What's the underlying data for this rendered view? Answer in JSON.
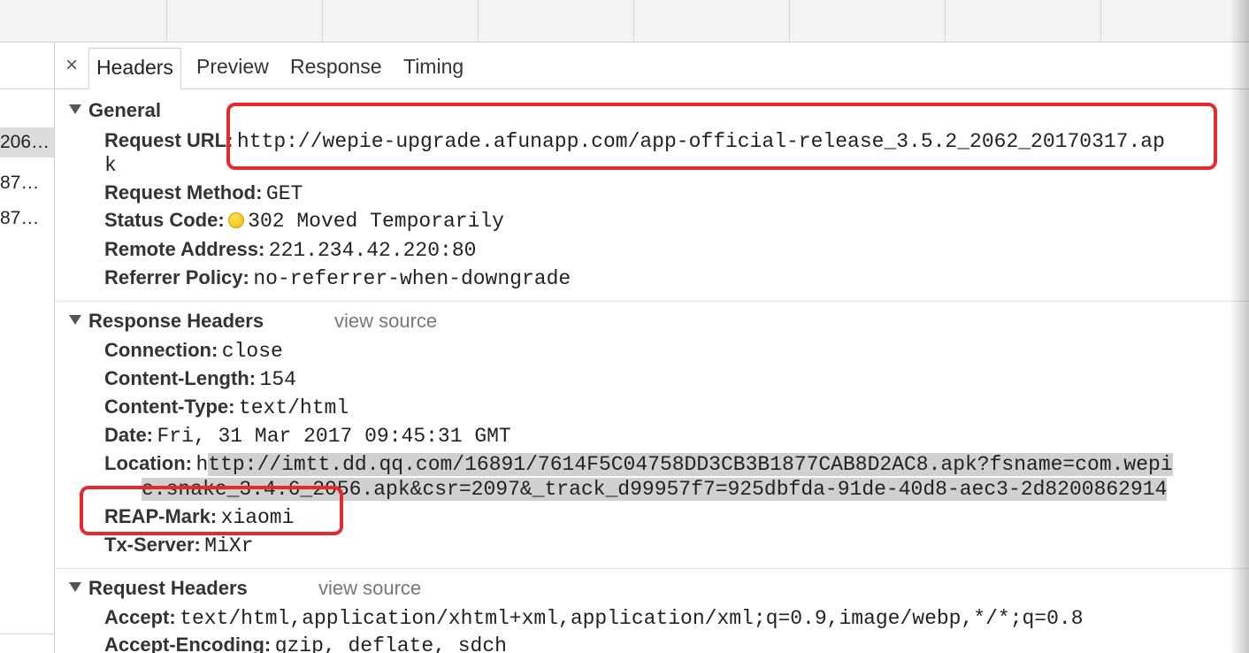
{
  "request_list": {
    "rows": [
      "206…",
      "87…",
      "87…"
    ]
  },
  "tabs": {
    "close_glyph": "×",
    "items": [
      "Headers",
      "Preview",
      "Response",
      "Timing"
    ],
    "active": "Headers"
  },
  "general": {
    "title": "General",
    "request_url_label": "Request URL:",
    "request_url_line1": "http://wepie-upgrade.afunapp.com/app-official-release_3.5.2_2062_20170317.ap",
    "request_url_line2": "k",
    "method_label": "Request Method:",
    "method": "GET",
    "status_label": "Status Code:",
    "status": "302 Moved Temporarily",
    "status_color": "#f2b600",
    "remote_label": "Remote Address:",
    "remote": "221.234.42.220:80",
    "referrer_label": "Referrer Policy:",
    "referrer": "no-referrer-when-downgrade"
  },
  "response_headers": {
    "title": "Response Headers",
    "view_source": "view source",
    "connection_label": "Connection:",
    "connection": "close",
    "content_length_label": "Content-Length:",
    "content_length": "154",
    "content_type_label": "Content-Type:",
    "content_type": "text/html",
    "date_label": "Date:",
    "date": "Fri, 31 Mar 2017 09:45:31 GMT",
    "location_label": "Location:",
    "location_line1_plain": "h",
    "location_line1_hl": "ttp://imtt.dd.qq.com/16891/7614F5C04758DD3CB3B1877CAB8D2AC8.apk?fsname=com.wepi",
    "location_line2": "e.snake_3.4.6_2056.apk&csr=2097&_track_d99957f7=925dbfda-91de-40d8-aec3-2d8200862914",
    "reap_label": "REAP-Mark:",
    "reap": "xiaomi",
    "tx_label": "Tx-Server:",
    "tx": "MiXr"
  },
  "request_headers": {
    "title": "Request Headers",
    "view_source": "view source",
    "accept_label": "Accept:",
    "accept": "text/html,application/xhtml+xml,application/xml;q=0.9,image/webp,*/*;q=0.8",
    "accept_encoding_label": "Accept-Encoding:",
    "accept_encoding": "gzip, deflate, sdch"
  },
  "annotation_color": "#e8282c"
}
